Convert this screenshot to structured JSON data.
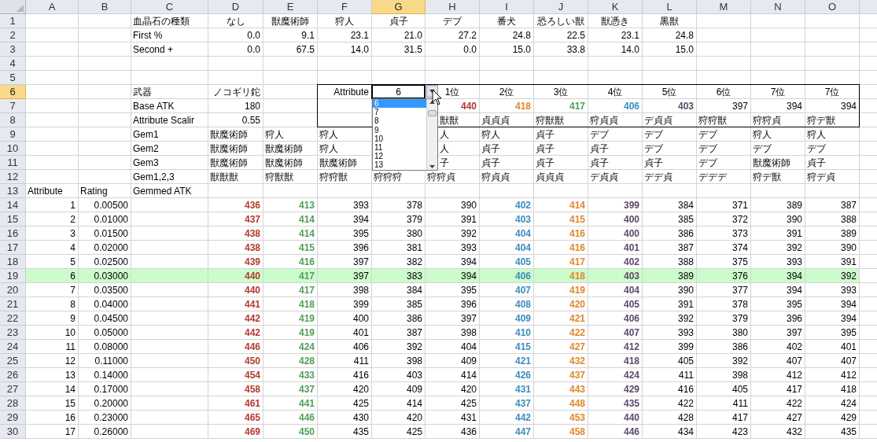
{
  "columns": [
    {
      "label": "A",
      "selected": false
    },
    {
      "label": "B",
      "selected": false
    },
    {
      "label": "C",
      "selected": false
    },
    {
      "label": "D",
      "selected": false
    },
    {
      "label": "E",
      "selected": false
    },
    {
      "label": "F",
      "selected": false
    },
    {
      "label": "G",
      "selected": true
    },
    {
      "label": "H",
      "selected": false
    },
    {
      "label": "I",
      "selected": false
    },
    {
      "label": "J",
      "selected": false
    },
    {
      "label": "K",
      "selected": false
    },
    {
      "label": "L",
      "selected": false
    },
    {
      "label": "M",
      "selected": false
    },
    {
      "label": "N",
      "selected": false
    },
    {
      "label": "O",
      "selected": false
    }
  ],
  "rows": [
    {
      "number": "1",
      "selected": false,
      "highlighted": false,
      "kind": "text",
      "cells": [
        null,
        null,
        "血晶石の種類",
        {
          "text": "なし",
          "kind": "center"
        },
        {
          "text": "獣魔術師",
          "kind": "center"
        },
        {
          "text": "狩人",
          "kind": "center"
        },
        {
          "text": "貞子",
          "kind": "center"
        },
        {
          "text": "デブ",
          "kind": "center"
        },
        {
          "text": "番犬",
          "kind": "center"
        },
        {
          "text": "恐ろしい獣",
          "kind": "center"
        },
        {
          "text": "獣憑き",
          "kind": "center"
        },
        {
          "text": "黒獣",
          "kind": "center"
        },
        null,
        null,
        null
      ]
    },
    {
      "number": "2",
      "selected": false,
      "highlighted": false,
      "kind": "numbers",
      "cells": [
        null,
        null,
        {
          "text": "First %",
          "kind": "label"
        },
        "0.0",
        "9.1",
        "23.1",
        "21.0",
        "27.2",
        "24.8",
        "22.5",
        "23.1",
        "24.8",
        null,
        null,
        null
      ]
    },
    {
      "number": "3",
      "selected": false,
      "highlighted": false,
      "kind": "numbers",
      "cells": [
        null,
        null,
        {
          "text": "Second +",
          "kind": "label"
        },
        "0.0",
        "67.5",
        "14.0",
        "31.5",
        "0.0",
        "15.0",
        "33.8",
        "14.0",
        "15.0",
        null,
        null,
        null
      ]
    },
    {
      "number": "4",
      "selected": false,
      "highlighted": false,
      "kind": "text",
      "cells": [
        null,
        null,
        null,
        null,
        null,
        null,
        null,
        null,
        null,
        null,
        null,
        null,
        null,
        null,
        null
      ]
    },
    {
      "number": "5",
      "selected": false,
      "highlighted": false,
      "kind": "text",
      "cells": [
        null,
        null,
        null,
        null,
        null,
        null,
        null,
        null,
        null,
        null,
        null,
        null,
        null,
        null,
        null
      ]
    },
    {
      "number": "6",
      "selected": true,
      "highlighted": false,
      "kind": "text",
      "cells": [
        null,
        null,
        "武器",
        {
          "text": "ノコギリ鉈",
          "kind": "number"
        },
        null,
        {
          "text": "Attribute",
          "kind": "number"
        },
        {
          "text": "6",
          "kind": "active"
        },
        {
          "text": "1位",
          "kind": "center"
        },
        {
          "text": "2位",
          "kind": "center"
        },
        {
          "text": "3位",
          "kind": "center"
        },
        {
          "text": "4位",
          "kind": "center"
        },
        {
          "text": "5位",
          "kind": "center"
        },
        {
          "text": "6位",
          "kind": "center"
        },
        {
          "text": "7位",
          "kind": "center"
        },
        {
          "text": "7位",
          "kind": "center"
        }
      ]
    },
    {
      "number": "7",
      "selected": false,
      "highlighted": false,
      "kind": "numbers",
      "cells": [
        null,
        null,
        {
          "text": "Base ATK",
          "kind": "label"
        },
        "180",
        null,
        null,
        null,
        {
          "text": "440",
          "color": "#b5382e"
        },
        {
          "text": "418",
          "color": "#e0872a"
        },
        {
          "text": "417",
          "color": "#4f9e57"
        },
        {
          "text": "406",
          "color": "#3a8dbd"
        },
        {
          "text": "403",
          "color": "#5c4a6b"
        },
        "397",
        "394",
        "394"
      ]
    },
    {
      "number": "8",
      "selected": false,
      "highlighted": false,
      "kind": "text",
      "cells": [
        null,
        null,
        "Attribute Scalir",
        {
          "text": "0.55",
          "kind": "number"
        },
        null,
        null,
        null,
        {
          "text": "獣獣",
          "kind": "partial"
        },
        "貞貞貞",
        "狩獣獣",
        "狩貞貞",
        "デ貞貞",
        "狩狩獣",
        "狩狩貞",
        "狩デ獣"
      ]
    },
    {
      "number": "9",
      "selected": false,
      "highlighted": false,
      "kind": "text",
      "cells": [
        null,
        null,
        "Gem1",
        "獣魔術師",
        "狩人",
        "狩人",
        null,
        {
          "text": "人",
          "kind": "partial"
        },
        "狩人",
        "貞子",
        "デブ",
        "デブ",
        "デブ",
        "狩人",
        "狩人"
      ]
    },
    {
      "number": "10",
      "selected": false,
      "highlighted": false,
      "kind": "text",
      "cells": [
        null,
        null,
        "Gem2",
        "獣魔術師",
        "獣魔術師",
        "狩人",
        null,
        {
          "text": "人",
          "kind": "partial"
        },
        "貞子",
        "貞子",
        "貞子",
        "デブ",
        "デブ",
        "デブ",
        "デブ"
      ]
    },
    {
      "number": "11",
      "selected": false,
      "highlighted": false,
      "kind": "text",
      "cells": [
        null,
        null,
        "Gem3",
        "獣魔術師",
        "獣魔術師",
        "獣魔術師",
        null,
        {
          "text": "子",
          "kind": "partial"
        },
        "貞子",
        "貞子",
        "貞子",
        "貞子",
        "デブ",
        "獣魔術師",
        "貞子"
      ]
    },
    {
      "number": "12",
      "selected": false,
      "highlighted": false,
      "kind": "text",
      "cells": [
        null,
        null,
        "Gem1,2,3",
        "獣獣獣",
        "狩獣獣",
        "狩狩獣",
        "狩狩狩",
        "狩狩貞",
        "狩貞貞",
        "貞貞貞",
        "デ貞貞",
        "デデ貞",
        "デデデ",
        "狩デ獣",
        "狩デ貞"
      ]
    },
    {
      "number": "13",
      "selected": false,
      "highlighted": false,
      "kind": "text",
      "cells": [
        "Attribute",
        "Rating",
        "Gemmed ATK",
        null,
        null,
        null,
        null,
        null,
        null,
        null,
        null,
        null,
        null,
        null,
        null
      ]
    },
    {
      "number": "14",
      "selected": false,
      "highlighted": false,
      "kind": "numbers",
      "cells": [
        "1",
        "0.00500",
        null,
        {
          "text": "436",
          "color": "#b5382e"
        },
        {
          "text": "413",
          "color": "#4f9e57"
        },
        "393",
        "378",
        "390",
        {
          "text": "402",
          "color": "#3a8dbd"
        },
        {
          "text": "414",
          "color": "#e0872a"
        },
        {
          "text": "399",
          "color": "#5c4a6b"
        },
        "384",
        "371",
        "389",
        "387"
      ]
    },
    {
      "number": "15",
      "selected": false,
      "highlighted": false,
      "kind": "numbers",
      "cells": [
        "2",
        "0.01000",
        null,
        {
          "text": "437",
          "color": "#b5382e"
        },
        {
          "text": "414",
          "color": "#4f9e57"
        },
        "394",
        "379",
        "391",
        {
          "text": "403",
          "color": "#3a8dbd"
        },
        {
          "text": "415",
          "color": "#e0872a"
        },
        {
          "text": "400",
          "color": "#5c4a6b"
        },
        "385",
        "372",
        "390",
        "388"
      ]
    },
    {
      "number": "16",
      "selected": false,
      "highlighted": false,
      "kind": "numbers",
      "cells": [
        "3",
        "0.01500",
        null,
        {
          "text": "438",
          "color": "#b5382e"
        },
        {
          "text": "414",
          "color": "#4f9e57"
        },
        "395",
        "380",
        "392",
        {
          "text": "404",
          "color": "#3a8dbd"
        },
        {
          "text": "416",
          "color": "#e0872a"
        },
        {
          "text": "400",
          "color": "#5c4a6b"
        },
        "386",
        "373",
        "391",
        "389"
      ]
    },
    {
      "number": "17",
      "selected": false,
      "highlighted": false,
      "kind": "numbers",
      "cells": [
        "4",
        "0.02000",
        null,
        {
          "text": "438",
          "color": "#b5382e"
        },
        {
          "text": "415",
          "color": "#4f9e57"
        },
        "396",
        "381",
        "393",
        {
          "text": "404",
          "color": "#3a8dbd"
        },
        {
          "text": "416",
          "color": "#e0872a"
        },
        {
          "text": "401",
          "color": "#5c4a6b"
        },
        "387",
        "374",
        "392",
        "390"
      ]
    },
    {
      "number": "18",
      "selected": false,
      "highlighted": false,
      "kind": "numbers",
      "cells": [
        "5",
        "0.02500",
        null,
        {
          "text": "439",
          "color": "#b5382e"
        },
        {
          "text": "416",
          "color": "#4f9e57"
        },
        "397",
        "382",
        "394",
        {
          "text": "405",
          "color": "#3a8dbd"
        },
        {
          "text": "417",
          "color": "#e0872a"
        },
        {
          "text": "402",
          "color": "#5c4a6b"
        },
        "388",
        "375",
        "393",
        "391"
      ]
    },
    {
      "number": "19",
      "selected": false,
      "highlighted": true,
      "kind": "numbers",
      "cells": [
        "6",
        "0.03000",
        null,
        {
          "text": "440",
          "color": "#b5382e"
        },
        {
          "text": "417",
          "color": "#4f9e57"
        },
        "397",
        "383",
        "394",
        {
          "text": "406",
          "color": "#3a8dbd"
        },
        {
          "text": "418",
          "color": "#e0872a"
        },
        {
          "text": "403",
          "color": "#5c4a6b"
        },
        "389",
        "376",
        "394",
        "392"
      ]
    },
    {
      "number": "20",
      "selected": false,
      "highlighted": false,
      "kind": "numbers",
      "cells": [
        "7",
        "0.03500",
        null,
        {
          "text": "440",
          "color": "#b5382e"
        },
        {
          "text": "417",
          "color": "#4f9e57"
        },
        "398",
        "384",
        "395",
        {
          "text": "407",
          "color": "#3a8dbd"
        },
        {
          "text": "419",
          "color": "#e0872a"
        },
        {
          "text": "404",
          "color": "#5c4a6b"
        },
        "390",
        "377",
        "394",
        "393"
      ]
    },
    {
      "number": "21",
      "selected": false,
      "highlighted": false,
      "kind": "numbers",
      "cells": [
        "8",
        "0.04000",
        null,
        {
          "text": "441",
          "color": "#b5382e"
        },
        {
          "text": "418",
          "color": "#4f9e57"
        },
        "399",
        "385",
        "396",
        {
          "text": "408",
          "color": "#3a8dbd"
        },
        {
          "text": "420",
          "color": "#e0872a"
        },
        {
          "text": "405",
          "color": "#5c4a6b"
        },
        "391",
        "378",
        "395",
        "394"
      ]
    },
    {
      "number": "22",
      "selected": false,
      "highlighted": false,
      "kind": "numbers",
      "cells": [
        "9",
        "0.04500",
        null,
        {
          "text": "442",
          "color": "#b5382e"
        },
        {
          "text": "419",
          "color": "#4f9e57"
        },
        "400",
        "386",
        "397",
        {
          "text": "409",
          "color": "#3a8dbd"
        },
        {
          "text": "421",
          "color": "#e0872a"
        },
        {
          "text": "406",
          "color": "#5c4a6b"
        },
        "392",
        "379",
        "396",
        "394"
      ]
    },
    {
      "number": "23",
      "selected": false,
      "highlighted": false,
      "kind": "numbers",
      "cells": [
        "10",
        "0.05000",
        null,
        {
          "text": "442",
          "color": "#b5382e"
        },
        {
          "text": "419",
          "color": "#4f9e57"
        },
        "401",
        "387",
        "398",
        {
          "text": "410",
          "color": "#3a8dbd"
        },
        {
          "text": "422",
          "color": "#e0872a"
        },
        {
          "text": "407",
          "color": "#5c4a6b"
        },
        "393",
        "380",
        "397",
        "395"
      ]
    },
    {
      "number": "24",
      "selected": false,
      "highlighted": false,
      "kind": "numbers",
      "cells": [
        "11",
        "0.08000",
        null,
        {
          "text": "446",
          "color": "#b5382e"
        },
        {
          "text": "424",
          "color": "#4f9e57"
        },
        "406",
        "392",
        "404",
        {
          "text": "415",
          "color": "#3a8dbd"
        },
        {
          "text": "427",
          "color": "#e0872a"
        },
        {
          "text": "412",
          "color": "#5c4a6b"
        },
        "399",
        "386",
        "402",
        "401"
      ]
    },
    {
      "number": "25",
      "selected": false,
      "highlighted": false,
      "kind": "numbers",
      "cells": [
        "12",
        "0.11000",
        null,
        {
          "text": "450",
          "color": "#b5382e"
        },
        {
          "text": "428",
          "color": "#4f9e57"
        },
        "411",
        "398",
        "409",
        {
          "text": "421",
          "color": "#3a8dbd"
        },
        {
          "text": "432",
          "color": "#e0872a"
        },
        {
          "text": "418",
          "color": "#5c4a6b"
        },
        "405",
        "392",
        "407",
        "407"
      ]
    },
    {
      "number": "26",
      "selected": false,
      "highlighted": false,
      "kind": "numbers",
      "cells": [
        "13",
        "0.14000",
        null,
        {
          "text": "454",
          "color": "#b5382e"
        },
        {
          "text": "433",
          "color": "#4f9e57"
        },
        "416",
        "403",
        "414",
        {
          "text": "426",
          "color": "#3a8dbd"
        },
        {
          "text": "437",
          "color": "#e0872a"
        },
        {
          "text": "424",
          "color": "#5c4a6b"
        },
        "411",
        "398",
        "412",
        "412"
      ]
    },
    {
      "number": "27",
      "selected": false,
      "highlighted": false,
      "kind": "numbers",
      "cells": [
        "14",
        "0.17000",
        null,
        {
          "text": "458",
          "color": "#b5382e"
        },
        {
          "text": "437",
          "color": "#4f9e57"
        },
        "420",
        "409",
        "420",
        {
          "text": "431",
          "color": "#3a8dbd"
        },
        {
          "text": "443",
          "color": "#e0872a"
        },
        {
          "text": "429",
          "color": "#5c4a6b"
        },
        "416",
        "405",
        "417",
        "418"
      ]
    },
    {
      "number": "28",
      "selected": false,
      "highlighted": false,
      "kind": "numbers",
      "cells": [
        "15",
        "0.20000",
        null,
        {
          "text": "461",
          "color": "#b5382e"
        },
        {
          "text": "441",
          "color": "#4f9e57"
        },
        "425",
        "414",
        "425",
        {
          "text": "437",
          "color": "#3a8dbd"
        },
        {
          "text": "448",
          "color": "#e0872a"
        },
        {
          "text": "435",
          "color": "#5c4a6b"
        },
        "422",
        "411",
        "422",
        "424"
      ]
    },
    {
      "number": "29",
      "selected": false,
      "highlighted": false,
      "kind": "numbers",
      "cells": [
        "16",
        "0.23000",
        null,
        {
          "text": "465",
          "color": "#b5382e"
        },
        {
          "text": "446",
          "color": "#4f9e57"
        },
        "430",
        "420",
        "431",
        {
          "text": "442",
          "color": "#3a8dbd"
        },
        {
          "text": "453",
          "color": "#e0872a"
        },
        {
          "text": "440",
          "color": "#5c4a6b"
        },
        "428",
        "417",
        "427",
        "429"
      ]
    },
    {
      "number": "30",
      "selected": false,
      "highlighted": false,
      "kind": "numbers",
      "cells": [
        "17",
        "0.26000",
        null,
        {
          "text": "469",
          "color": "#b5382e"
        },
        {
          "text": "450",
          "color": "#4f9e57"
        },
        "435",
        "425",
        "436",
        {
          "text": "447",
          "color": "#3a8dbd"
        },
        {
          "text": "458",
          "color": "#e0872a"
        },
        {
          "text": "446",
          "color": "#5c4a6b"
        },
        "434",
        "423",
        "432",
        "435"
      ]
    }
  ],
  "dropdown": {
    "items": [
      {
        "label": "6",
        "selected": true
      },
      {
        "label": "7",
        "selected": false
      },
      {
        "label": "8",
        "selected": false
      },
      {
        "label": "9",
        "selected": false
      },
      {
        "label": "10",
        "selected": false
      },
      {
        "label": "11",
        "selected": false
      },
      {
        "label": "12",
        "selected": false
      },
      {
        "label": "13",
        "selected": false
      }
    ]
  }
}
